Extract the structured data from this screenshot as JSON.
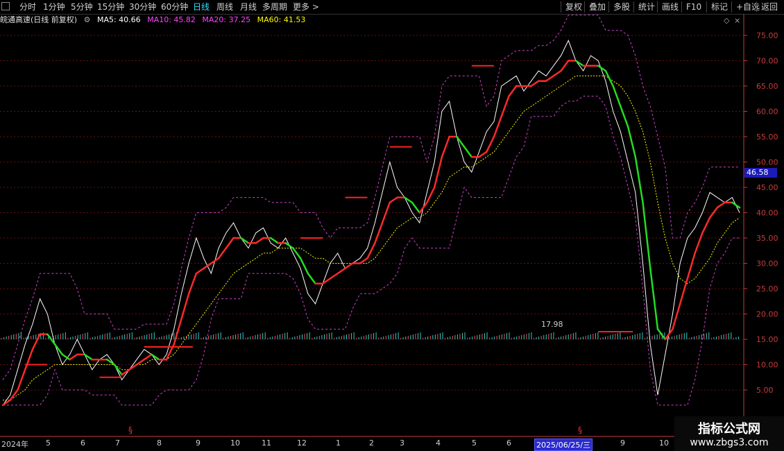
{
  "toolbar": {
    "left": [
      "分时",
      "1分钟",
      "5分钟",
      "15分钟",
      "30分钟",
      "60分钟",
      "日线",
      "周线",
      "月线",
      "多周期",
      "更多 >"
    ],
    "active_index": 6,
    "right": [
      "复权",
      "叠加",
      "多股",
      "统计",
      "画线",
      "F10",
      "标记",
      "+自选",
      "返回"
    ]
  },
  "info": {
    "title": "皖通高速(日线 前复权)",
    "ma5": "MA5: 40.66",
    "ma10": "MA10: 45.82",
    "ma20": "MA20: 37.25",
    "ma60": "MA60: 41.53"
  },
  "colors": {
    "ma5": "#ffffff",
    "ma10": "#ff44ff",
    "ma20": "#ff44ff",
    "ma60": "#ffff00",
    "grid": "#6a1010",
    "axis": "#c83c3c",
    "up": "#ff2a2a",
    "down": "#22dd22"
  },
  "price_tag": "46.58",
  "volume_label": "17.98",
  "chart_data": {
    "type": "line",
    "ylim": [
      2,
      78
    ],
    "yticks": [
      "75.00",
      "70.00",
      "65.00",
      "60.00",
      "55.00",
      "50.00",
      "45.00",
      "40.00",
      "35.00",
      "30.00",
      "25.00",
      "20.00",
      "15.00",
      "10.00",
      "5.00"
    ],
    "x_labels": [
      "2024年",
      "5",
      "6",
      "7",
      "8",
      "9",
      "10",
      "11",
      "12",
      "1",
      "2",
      "3",
      "4",
      "5",
      "6",
      "2025/06/25/三",
      "9",
      "10"
    ],
    "series": [
      {
        "name": "MA5",
        "values": [
          2,
          4,
          9,
          14,
          18,
          23,
          20,
          14,
          10,
          12,
          15,
          12,
          9,
          11,
          12,
          10,
          7,
          9,
          11,
          13,
          12,
          10,
          12,
          17,
          24,
          30,
          35,
          31,
          28,
          33,
          36,
          38,
          35,
          33,
          36,
          37,
          34,
          33,
          35,
          32,
          29,
          24,
          22,
          26,
          30,
          32,
          29,
          30,
          31,
          33,
          38,
          44,
          50,
          45,
          43,
          40,
          38,
          44,
          50,
          60,
          62,
          55,
          50,
          48,
          52,
          56,
          58,
          65,
          66,
          67,
          64,
          66,
          68,
          67,
          69,
          71,
          74,
          70,
          68,
          71,
          70,
          66,
          60,
          56,
          50,
          44,
          30,
          14,
          4,
          12,
          20,
          30,
          35,
          37,
          40,
          44,
          43,
          42,
          43,
          40
        ]
      },
      {
        "name": "MA20",
        "values": [
          2,
          3,
          5,
          9,
          13,
          16,
          16,
          14,
          12,
          11,
          12,
          12,
          11,
          11,
          11,
          10,
          8,
          9,
          10,
          11,
          12,
          11,
          11,
          14,
          19,
          24,
          28,
          29,
          30,
          31,
          33,
          35,
          35,
          34,
          34,
          35,
          35,
          34,
          34,
          33,
          31,
          28,
          26,
          26,
          27,
          28,
          29,
          30,
          30,
          31,
          34,
          38,
          42,
          43,
          43,
          42,
          40,
          42,
          45,
          51,
          55,
          55,
          53,
          51,
          51,
          52,
          55,
          59,
          63,
          65,
          65,
          65,
          66,
          66,
          67,
          68,
          70,
          70,
          69,
          69,
          69,
          68,
          65,
          61,
          57,
          51,
          42,
          29,
          17,
          15,
          17,
          22,
          27,
          32,
          36,
          39,
          41,
          42,
          42,
          41
        ]
      },
      {
        "name": "MA60",
        "values": [
          3,
          3,
          4,
          5,
          7,
          8,
          9,
          10,
          10,
          10,
          10,
          10,
          10,
          10,
          10,
          10,
          9,
          9,
          10,
          10,
          11,
          11,
          11,
          12,
          14,
          16,
          18,
          20,
          22,
          24,
          26,
          28,
          29,
          30,
          31,
          32,
          32,
          33,
          33,
          33,
          33,
          32,
          31,
          31,
          30,
          30,
          30,
          30,
          30,
          30,
          31,
          33,
          35,
          37,
          38,
          39,
          39,
          40,
          42,
          44,
          47,
          48,
          49,
          49,
          50,
          51,
          52,
          54,
          56,
          58,
          60,
          61,
          62,
          63,
          64,
          65,
          66,
          67,
          67,
          67,
          67,
          67,
          66,
          65,
          63,
          60,
          56,
          50,
          42,
          35,
          30,
          27,
          26,
          27,
          29,
          31,
          34,
          36,
          38,
          39
        ]
      }
    ]
  }
}
